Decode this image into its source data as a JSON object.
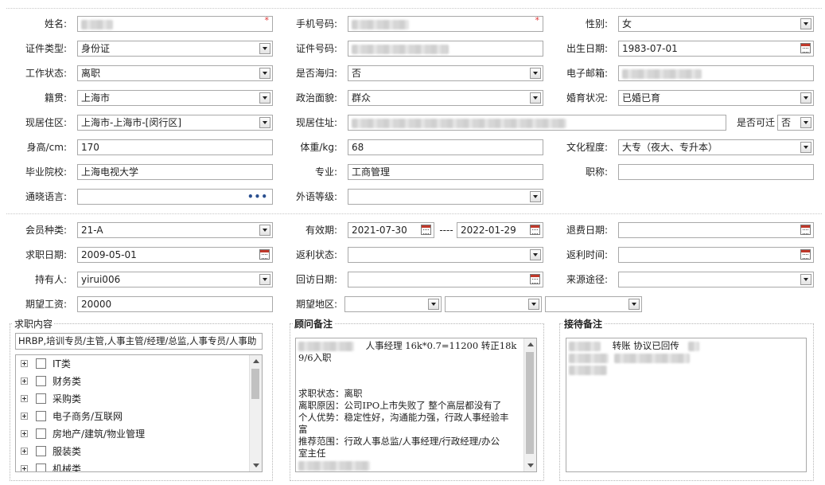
{
  "labels": {
    "name": "姓名:",
    "phone": "手机号码:",
    "gender": "性别:",
    "id_type": "证件类型:",
    "id_no": "证件号码:",
    "birth": "出生日期:",
    "work_status": "工作状态:",
    "returnee": "是否海归:",
    "email": "电子邮箱:",
    "native": "籍贯:",
    "political": "政治面貌:",
    "marital": "婚育状况:",
    "residence": "现居住区:",
    "address": "现居住址:",
    "relocate": "是否可迁",
    "height": "身高/cm:",
    "weight": "体重/kg:",
    "education": "文化程度:",
    "school": "毕业院校:",
    "major": "专业:",
    "title": "职称:",
    "language": "通晓语言:",
    "foreign_level": "外语等级:",
    "member_type": "会员种类:",
    "valid_period": "有效期:",
    "refund_date": "退费日期:",
    "job_date": "求职日期:",
    "rebate_status": "返利状态:",
    "rebate_time": "返利时间:",
    "holder": "持有人:",
    "visit_date": "回访日期:",
    "source": "来源途径:",
    "salary": "期望工资:",
    "region": "期望地区:"
  },
  "values": {
    "gender": "女",
    "id_type": "身份证",
    "birth": "1983-07-01",
    "work_status": "离职",
    "returnee": "否",
    "native": "上海市",
    "political": "群众",
    "marital": "已婚已育",
    "residence": "上海市-上海市-[闵行区]",
    "relocate": "否",
    "height": "170",
    "weight": "68",
    "education": "大专（夜大、专升本）",
    "school": "上海电视大学",
    "major": "工商管理",
    "member_type": "21-A",
    "valid_from": "2021-07-30",
    "valid_sep": "----",
    "valid_to": "2022-01-29",
    "job_date": "2009-05-01",
    "holder": "yirui006",
    "salary": "20000",
    "language_btn": "•••"
  },
  "job_intent": {
    "title": "求职内容",
    "summary": "HRBP,培训专员/主管,人事主管/经理/总监,人事专员/人事助",
    "tree": [
      "IT类",
      "财务类",
      "采购类",
      "电子商务/互联网",
      "房地产/建筑/物业管理",
      "服装类",
      "机械类"
    ]
  },
  "advisor_note": {
    "title": "顾问备注",
    "lines": [
      "人事经理  16k*0.7=11200  转正18k",
      "9/6入职",
      "",
      "",
      "求职状态：离职",
      "离职原因：公司IPO上市失败了 整个高层都没有了",
      "个人优势：稳定性好，沟通能力强，行政人事经验丰",
      "富",
      "推荐范围：行政人事总监/人事经理/行政经理/办公",
      "室主任"
    ]
  },
  "reception_note": {
    "title": "接待备注",
    "text": "转账  协议已回传"
  },
  "colors": {
    "required_star": "#dd3333",
    "border": "#a9a9a9",
    "cal_red": "#c0392b"
  }
}
